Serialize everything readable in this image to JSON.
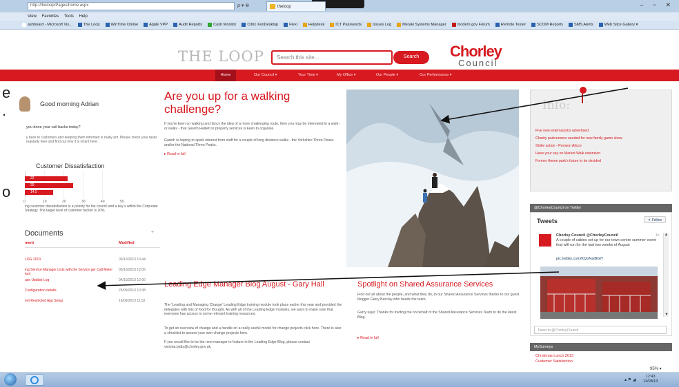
{
  "browser": {
    "url": "http://theloop/Pages/home.aspx",
    "address_controls": "ρ ▾ ⊗",
    "tab_title": "theloop",
    "window_controls": "– ▫ ✕",
    "menu": [
      "View",
      "Favorites",
      "Tools",
      "Help"
    ],
    "favorites": [
      {
        "label": "ashboard - Microsoft Vis...",
        "color": "#ffffff"
      },
      {
        "label": "The Loop",
        "color": "#2a62b0"
      },
      {
        "label": "WinTime Online",
        "color": "#2a62b0"
      },
      {
        "label": "Apple VPP",
        "color": "#2a62b0"
      },
      {
        "label": "Audit Reports",
        "color": "#2a62b0"
      },
      {
        "label": "Cash Monitor",
        "color": "#2fa32f"
      },
      {
        "label": "Citrix XenDesktop",
        "color": "#2a62b0"
      },
      {
        "label": "Flexi",
        "color": "#2a62b0"
      },
      {
        "label": "Helpdesk",
        "color": "#e8a317"
      },
      {
        "label": "ICT Passwords",
        "color": "#e8a317"
      },
      {
        "label": "Issues Log",
        "color": "#e8a317"
      },
      {
        "label": "Meraki Systems Manager",
        "color": "#e8a317"
      },
      {
        "label": "modern.gov Forum",
        "color": "#c41b1b"
      },
      {
        "label": "Remote Tester",
        "color": "#2a62b0"
      },
      {
        "label": "SCOM Reports",
        "color": "#2a62b0"
      },
      {
        "label": "SMS Alerts",
        "color": "#2a62b0"
      },
      {
        "label": "Web Slice Gallery ▾",
        "color": "#2a62b0"
      }
    ],
    "zoom": " 95% ▾"
  },
  "site": {
    "logo": "THE LOOP",
    "search_placeholder": "Search this site...",
    "search_button": "Search",
    "council_name": "Chorley",
    "council_sub": "Council",
    "nav": [
      "Home",
      "Our Council ▾",
      "Your Time ▾",
      "My Office ▾",
      "Our People ▾",
      "Our Performance ▾"
    ]
  },
  "left": {
    "greeting": "Good morning Adrian",
    "question": "you done your call backs today?",
    "question_sub": "y back to customers and keeping them informed is really ant. Please check your tasks regularly here and find out why it is ortant here.",
    "cd_title": "Customer Dissatisfaction",
    "cd_chart": {
      "type": "bar",
      "categories": [
        "",
        "",
        ""
      ],
      "values": [
        22,
        25,
        14.5
      ],
      "labels": [
        "22",
        "25",
        "14.5"
      ],
      "ticks": [
        "0",
        "10",
        "20",
        "30",
        "40",
        "50"
      ],
      "xlim": [
        0,
        50
      ]
    },
    "cd_desc": "ing customer dissatisfaction is a priority for the council and a key s within the Corporate Strategy. The target level of customer faction is 20%.",
    "docs_title": "Documents",
    "docs_plus": "+",
    "docs_col_name": "ment",
    "docs_col_mod": "Modified",
    "docs": [
      {
        "name": "LOG 2013",
        "date": "09/10/2013 10:44"
      },
      {
        "name": "ing Service Manager Lists with the Service ger Call Meter tool",
        "date": "09/10/2013 12:05"
      },
      {
        "name": "ase Update Log",
        "date": "04/10/2013 12:00"
      },
      {
        "name": "Configuration details",
        "date": "25/09/2013 10:38"
      },
      {
        "name": "ent Restricted App Setup",
        "date": "16/09/2013 11:52"
      }
    ]
  },
  "center": {
    "headline": "Are you up for a walking challenge?",
    "p1": "If you're keen on walking and fancy the idea of a more challenging route, then you may be interested in a walk - or walks - that Gareth Halliett in property services is keen to organise.",
    "p2": "Gareth is hoping to spark interest from staff for a couple of long distance walks - the Yorkshire Three Peaks and/or the National Three Peaks.",
    "read_full": "Read in full",
    "blog_title": "Leading Edge Manager Blog August - Gary Hall",
    "blog_p1": "The 'Leading and Managing Change' Leading Edge training module took place earlier this year and provided the delegates with lots of food for thought. As with all of the Leading Edge modules, we want to make sure that everyone has access to some relevant training resources.",
    "blog_p2": "To get an overview of change and a handle on a really useful model for change projects click here. There is also a checklist to assess your own change projects here.",
    "blog_p3": "If you would like to be the next manager to feature in the Leading Edge Blog, please contact victoria.batty@chorley.gov.uk.",
    "shared_title": "Spotlight on Shared Assurance Services",
    "shared_p1": "Find out all about the people, and what they do, in our Shared Assurance Services thanks to our guest blogger Garry Barclay who heads the team.",
    "shared_p2": "Garry says: Thanks for inviting me on behalf of the Shared Assurance Services Team to do the latest Blog.",
    "shared_read": "Read in full"
  },
  "right": {
    "info_title": "Info:",
    "info_items": [
      "Five new external jobs advertised",
      "Charity parkrunners needed for new family game show",
      "Strike action - Pension Alicce",
      "Have your say on Market Walk extension",
      "Former theme park's future to be decided"
    ],
    "twitter_header": "@ChorleyCouncil on Twitter",
    "tweets_title": "Tweets",
    "follow": "Follow",
    "tweet_name": "Chorley Council @ChorleyCouncil",
    "tweet_time": "1h",
    "tweet_text": "A couple of cabins set up for our town centre summer event that will run for the last two weeks of August",
    "tweet_link": "pic.twitter.com/KQoNaiBGiY",
    "tweet_input": "Tweet to @ChorleyCouncil",
    "mysurveys_header": "MySurveys",
    "surveys": [
      "Christmas Lunch 2013",
      "Customer Satisfaction"
    ]
  },
  "taskbar": {
    "time": "12:43",
    "date": "13/08/13",
    "tray": "▴ ⚑ ◢"
  },
  "annotations": {
    "partial_letters": [
      "e",
      ".",
      "o"
    ],
    "arrow_color": "#111111"
  }
}
